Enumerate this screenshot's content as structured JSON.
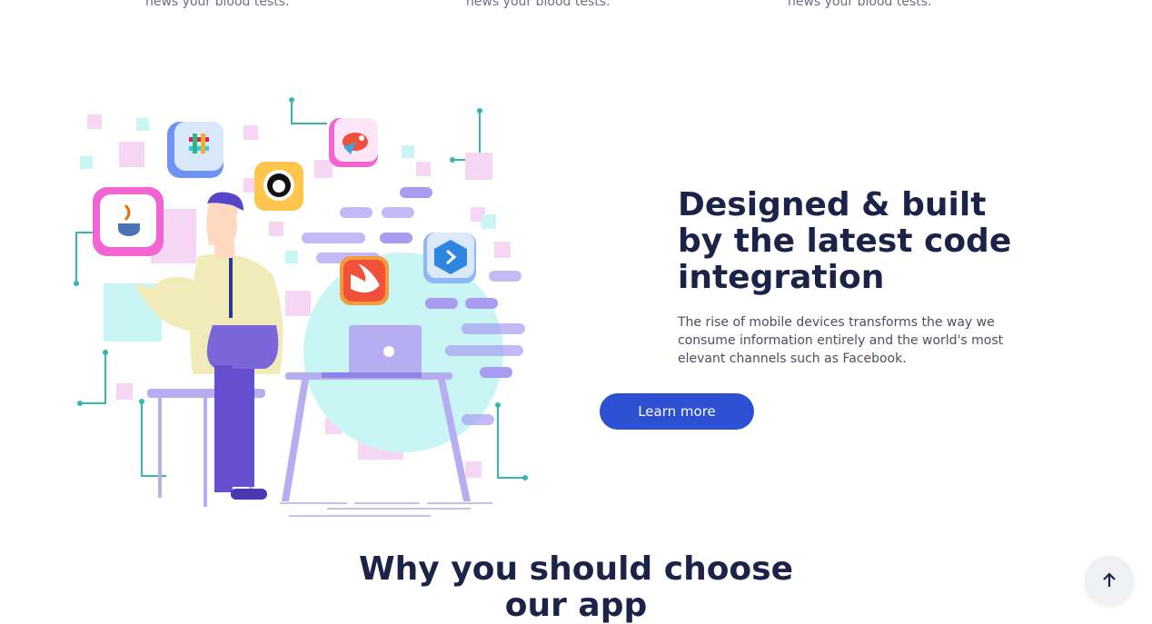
{
  "features_row": {
    "captions": [
      "news your blood tests.",
      "news your blood tests.",
      "news your blood tests."
    ]
  },
  "integration_section": {
    "headline": "Designed & built by the latest code integration",
    "description": "The rise of mobile devices transforms the way we consume information entirely and the world's most elevant channels such as Facebook.",
    "cta_label": "Learn more",
    "illustration_icons": [
      "slack-icon",
      "github-icon",
      "bird-icon",
      "java-icon",
      "swift-icon",
      "xcode-arrow-icon",
      "laptop-icon"
    ]
  },
  "why_section": {
    "title": "Why you should choose our app"
  },
  "scroll_top": {
    "icon": "arrow-up-icon"
  },
  "colors": {
    "accent": "#2d4fd1",
    "heading": "#1b2448",
    "purple": "#a79cf0",
    "pink": "#f6d7f3",
    "cyan": "#c9f5f5"
  }
}
